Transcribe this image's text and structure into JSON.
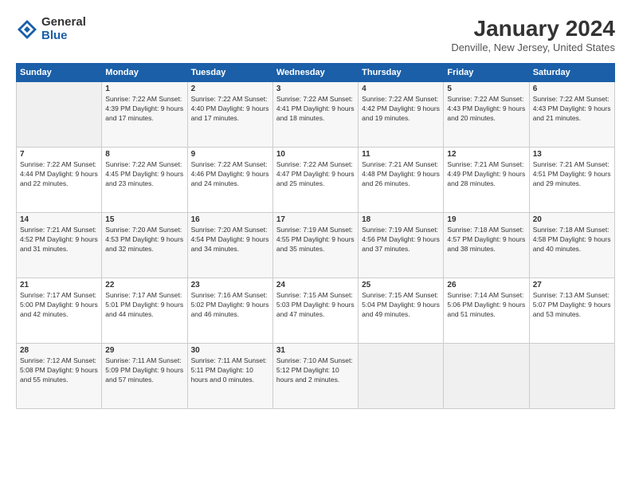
{
  "logo": {
    "general": "General",
    "blue": "Blue"
  },
  "title": "January 2024",
  "subtitle": "Denville, New Jersey, United States",
  "headers": [
    "Sunday",
    "Monday",
    "Tuesday",
    "Wednesday",
    "Thursday",
    "Friday",
    "Saturday"
  ],
  "weeks": [
    [
      {
        "num": "",
        "info": ""
      },
      {
        "num": "1",
        "info": "Sunrise: 7:22 AM\nSunset: 4:39 PM\nDaylight: 9 hours\nand 17 minutes."
      },
      {
        "num": "2",
        "info": "Sunrise: 7:22 AM\nSunset: 4:40 PM\nDaylight: 9 hours\nand 17 minutes."
      },
      {
        "num": "3",
        "info": "Sunrise: 7:22 AM\nSunset: 4:41 PM\nDaylight: 9 hours\nand 18 minutes."
      },
      {
        "num": "4",
        "info": "Sunrise: 7:22 AM\nSunset: 4:42 PM\nDaylight: 9 hours\nand 19 minutes."
      },
      {
        "num": "5",
        "info": "Sunrise: 7:22 AM\nSunset: 4:43 PM\nDaylight: 9 hours\nand 20 minutes."
      },
      {
        "num": "6",
        "info": "Sunrise: 7:22 AM\nSunset: 4:43 PM\nDaylight: 9 hours\nand 21 minutes."
      }
    ],
    [
      {
        "num": "7",
        "info": "Sunrise: 7:22 AM\nSunset: 4:44 PM\nDaylight: 9 hours\nand 22 minutes."
      },
      {
        "num": "8",
        "info": "Sunrise: 7:22 AM\nSunset: 4:45 PM\nDaylight: 9 hours\nand 23 minutes."
      },
      {
        "num": "9",
        "info": "Sunrise: 7:22 AM\nSunset: 4:46 PM\nDaylight: 9 hours\nand 24 minutes."
      },
      {
        "num": "10",
        "info": "Sunrise: 7:22 AM\nSunset: 4:47 PM\nDaylight: 9 hours\nand 25 minutes."
      },
      {
        "num": "11",
        "info": "Sunrise: 7:21 AM\nSunset: 4:48 PM\nDaylight: 9 hours\nand 26 minutes."
      },
      {
        "num": "12",
        "info": "Sunrise: 7:21 AM\nSunset: 4:49 PM\nDaylight: 9 hours\nand 28 minutes."
      },
      {
        "num": "13",
        "info": "Sunrise: 7:21 AM\nSunset: 4:51 PM\nDaylight: 9 hours\nand 29 minutes."
      }
    ],
    [
      {
        "num": "14",
        "info": "Sunrise: 7:21 AM\nSunset: 4:52 PM\nDaylight: 9 hours\nand 31 minutes."
      },
      {
        "num": "15",
        "info": "Sunrise: 7:20 AM\nSunset: 4:53 PM\nDaylight: 9 hours\nand 32 minutes."
      },
      {
        "num": "16",
        "info": "Sunrise: 7:20 AM\nSunset: 4:54 PM\nDaylight: 9 hours\nand 34 minutes."
      },
      {
        "num": "17",
        "info": "Sunrise: 7:19 AM\nSunset: 4:55 PM\nDaylight: 9 hours\nand 35 minutes."
      },
      {
        "num": "18",
        "info": "Sunrise: 7:19 AM\nSunset: 4:56 PM\nDaylight: 9 hours\nand 37 minutes."
      },
      {
        "num": "19",
        "info": "Sunrise: 7:18 AM\nSunset: 4:57 PM\nDaylight: 9 hours\nand 38 minutes."
      },
      {
        "num": "20",
        "info": "Sunrise: 7:18 AM\nSunset: 4:58 PM\nDaylight: 9 hours\nand 40 minutes."
      }
    ],
    [
      {
        "num": "21",
        "info": "Sunrise: 7:17 AM\nSunset: 5:00 PM\nDaylight: 9 hours\nand 42 minutes."
      },
      {
        "num": "22",
        "info": "Sunrise: 7:17 AM\nSunset: 5:01 PM\nDaylight: 9 hours\nand 44 minutes."
      },
      {
        "num": "23",
        "info": "Sunrise: 7:16 AM\nSunset: 5:02 PM\nDaylight: 9 hours\nand 46 minutes."
      },
      {
        "num": "24",
        "info": "Sunrise: 7:15 AM\nSunset: 5:03 PM\nDaylight: 9 hours\nand 47 minutes."
      },
      {
        "num": "25",
        "info": "Sunrise: 7:15 AM\nSunset: 5:04 PM\nDaylight: 9 hours\nand 49 minutes."
      },
      {
        "num": "26",
        "info": "Sunrise: 7:14 AM\nSunset: 5:06 PM\nDaylight: 9 hours\nand 51 minutes."
      },
      {
        "num": "27",
        "info": "Sunrise: 7:13 AM\nSunset: 5:07 PM\nDaylight: 9 hours\nand 53 minutes."
      }
    ],
    [
      {
        "num": "28",
        "info": "Sunrise: 7:12 AM\nSunset: 5:08 PM\nDaylight: 9 hours\nand 55 minutes."
      },
      {
        "num": "29",
        "info": "Sunrise: 7:11 AM\nSunset: 5:09 PM\nDaylight: 9 hours\nand 57 minutes."
      },
      {
        "num": "30",
        "info": "Sunrise: 7:11 AM\nSunset: 5:11 PM\nDaylight: 10 hours\nand 0 minutes."
      },
      {
        "num": "31",
        "info": "Sunrise: 7:10 AM\nSunset: 5:12 PM\nDaylight: 10 hours\nand 2 minutes."
      },
      {
        "num": "",
        "info": ""
      },
      {
        "num": "",
        "info": ""
      },
      {
        "num": "",
        "info": ""
      }
    ]
  ]
}
